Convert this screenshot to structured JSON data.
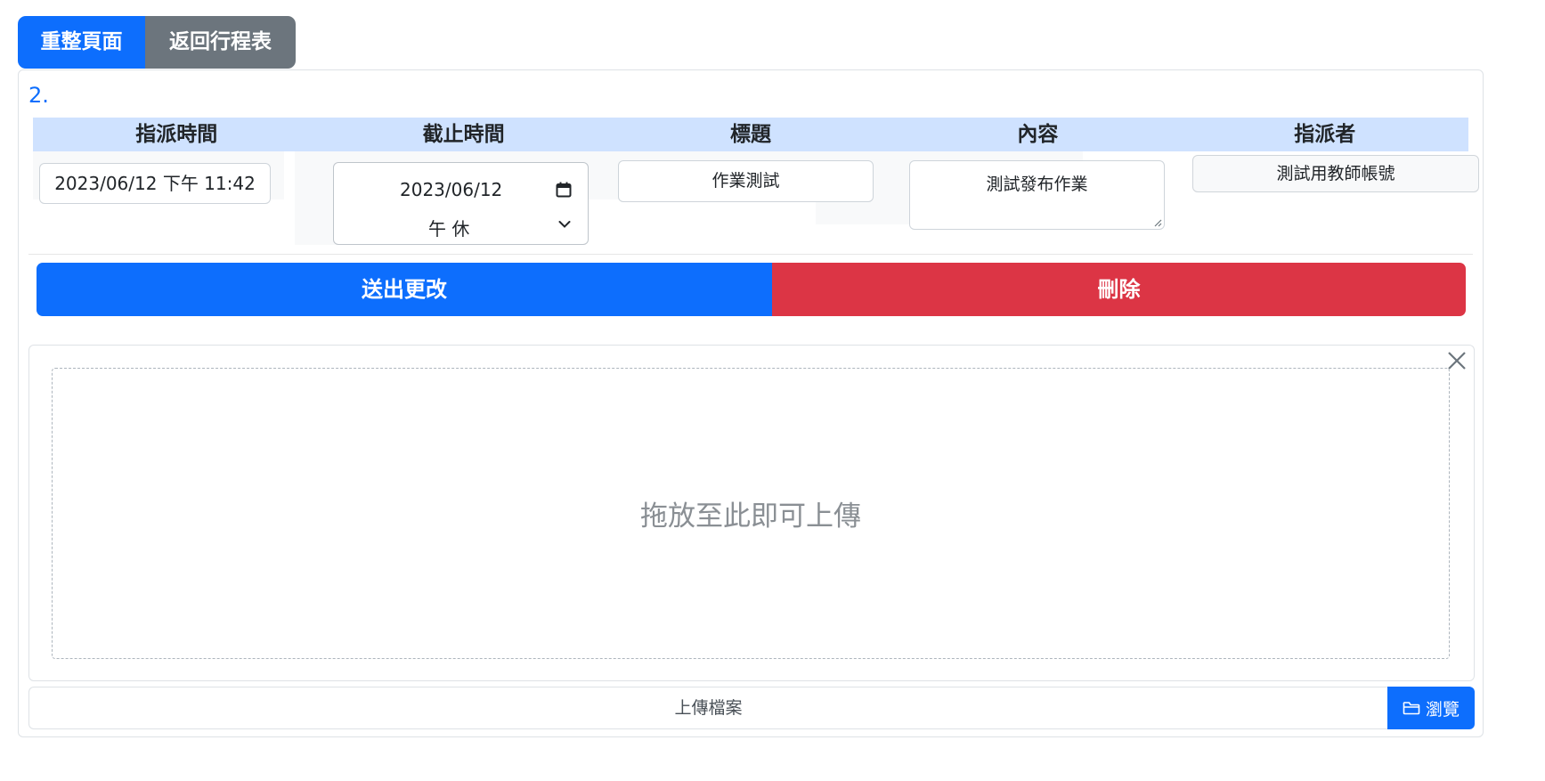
{
  "top_buttons": {
    "reload_label": "重整頁面",
    "back_label": "返回行程表"
  },
  "item": {
    "number": "2.",
    "headers": [
      "指派時間",
      "截止時間",
      "標題",
      "內容",
      "指派者"
    ],
    "assign_time": "2023/06/12 下午 11:42",
    "deadline_date": "2023/06/12",
    "deadline_period": "午 休",
    "title": "作業測試",
    "content": "測試發布作業",
    "assigner": "測試用教師帳號"
  },
  "actions": {
    "submit_label": "送出更改",
    "delete_label": "刪除"
  },
  "upload": {
    "drop_text": "拖放至此即可上傳",
    "caption_placeholder": "上傳檔案",
    "browse_label": "瀏覽"
  },
  "colors": {
    "primary": "#0d6efd",
    "secondary": "#6c757d",
    "danger": "#dc3545",
    "header_bg": "#cfe2ff"
  },
  "icons": {
    "calendar": "calendar-icon",
    "chevron": "chevron-down-icon",
    "close": "close-icon",
    "folder": "folder-open-icon",
    "resize": "resize-grip-icon"
  }
}
